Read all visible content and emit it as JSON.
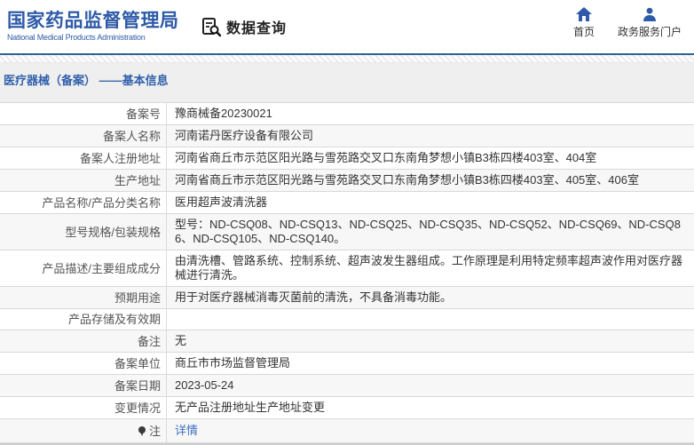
{
  "header": {
    "logo_title": "国家药品监督管理局",
    "logo_subtitle": "National Medical Products Administration",
    "section_title": "数据查询",
    "nav": [
      {
        "label": "首页",
        "icon": "home-icon"
      },
      {
        "label": "政务服务门户",
        "icon": "user-icon"
      }
    ]
  },
  "breadcrumb": "医疗器械（备案） ——基本信息",
  "colors": {
    "brand_blue": "#2e5aa7",
    "header_rule_blue": "#2a6496",
    "breadcrumb_blue": "#3060ab",
    "link_blue": "#3e6fc1",
    "row_alt_bg": "#f7f7f7",
    "border_gray": "#d9d9d9",
    "page_bg": "#efefef"
  },
  "table": {
    "rows": [
      {
        "label": "备案号",
        "value": "豫商械备20230021"
      },
      {
        "label": "备案人名称",
        "value": "河南诺丹医疗设备有限公司"
      },
      {
        "label": "备案人注册地址",
        "value": "河南省商丘市示范区阳光路与雪苑路交叉口东南角梦想小镇B3栋四楼403室、404室"
      },
      {
        "label": "生产地址",
        "value": "河南省商丘市示范区阳光路与雪苑路交叉口东南角梦想小镇B3栋四楼403室、405室、406室"
      },
      {
        "label": "产品名称/产品分类名称",
        "value": "医用超声波清洗器"
      },
      {
        "label": "型号规格/包装规格",
        "value": "型号：ND-CSQ08、ND-CSQ13、ND-CSQ25、ND-CSQ35、ND-CSQ52、ND-CSQ69、ND-CSQ86、ND-CSQ105、ND-CSQ140。"
      },
      {
        "label": "产品描述/主要组成成分",
        "value": "由清洗槽、管路系统、控制系统、超声波发生器组成。工作原理是利用特定频率超声波作用对医疗器械进行清洗。"
      },
      {
        "label": "预期用途",
        "value": "用于对医疗器械消毒灭菌前的清洗，不具备消毒功能。"
      },
      {
        "label": "产品存储及有效期",
        "value": ""
      },
      {
        "label": "备注",
        "value": "无"
      },
      {
        "label": "备案单位",
        "value": "商丘市市场监督管理局"
      },
      {
        "label": "备案日期",
        "value": "2023-05-24"
      },
      {
        "label": "变更情况",
        "value": "无产品注册地址生产地址变更"
      },
      {
        "label": "注",
        "value": "详情",
        "icon": "note-pin-icon"
      }
    ]
  }
}
